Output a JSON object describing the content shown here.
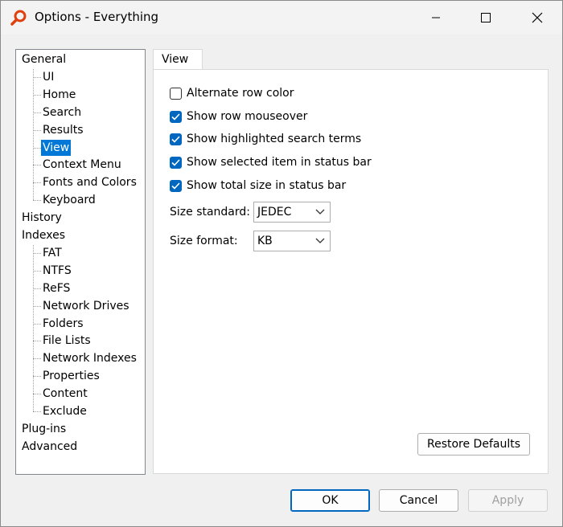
{
  "window": {
    "title": "Options - Everything"
  },
  "tree": [
    {
      "label": "General",
      "level": 0
    },
    {
      "label": "UI",
      "level": 1
    },
    {
      "label": "Home",
      "level": 1
    },
    {
      "label": "Search",
      "level": 1
    },
    {
      "label": "Results",
      "level": 1
    },
    {
      "label": "View",
      "level": 1,
      "selected": true
    },
    {
      "label": "Context Menu",
      "level": 1
    },
    {
      "label": "Fonts and Colors",
      "level": 1
    },
    {
      "label": "Keyboard",
      "level": 1
    },
    {
      "label": "History",
      "level": 0
    },
    {
      "label": "Indexes",
      "level": 0
    },
    {
      "label": "FAT",
      "level": 1
    },
    {
      "label": "NTFS",
      "level": 1
    },
    {
      "label": "ReFS",
      "level": 1
    },
    {
      "label": "Network Drives",
      "level": 1
    },
    {
      "label": "Folders",
      "level": 1
    },
    {
      "label": "File Lists",
      "level": 1
    },
    {
      "label": "Network Indexes",
      "level": 1
    },
    {
      "label": "Properties",
      "level": 1
    },
    {
      "label": "Content",
      "level": 1
    },
    {
      "label": "Exclude",
      "level": 1
    },
    {
      "label": "Plug-ins",
      "level": 0
    },
    {
      "label": "Advanced",
      "level": 0
    }
  ],
  "tab": {
    "label": "View"
  },
  "options": [
    {
      "label": "Alternate row color",
      "checked": false
    },
    {
      "label": "Show row mouseover",
      "checked": true
    },
    {
      "label": "Show highlighted search terms",
      "checked": true
    },
    {
      "label": "Show selected item in status bar",
      "checked": true
    },
    {
      "label": "Show total size in status bar",
      "checked": true
    }
  ],
  "size_standard": {
    "label": "Size standard:",
    "value": "JEDEC"
  },
  "size_format": {
    "label": "Size format:",
    "value": "KB"
  },
  "buttons": {
    "restore_defaults": "Restore Defaults",
    "ok": "OK",
    "cancel": "Cancel",
    "apply": "Apply"
  },
  "colors": {
    "accent": "#0067c0",
    "selection": "#0078d7"
  }
}
